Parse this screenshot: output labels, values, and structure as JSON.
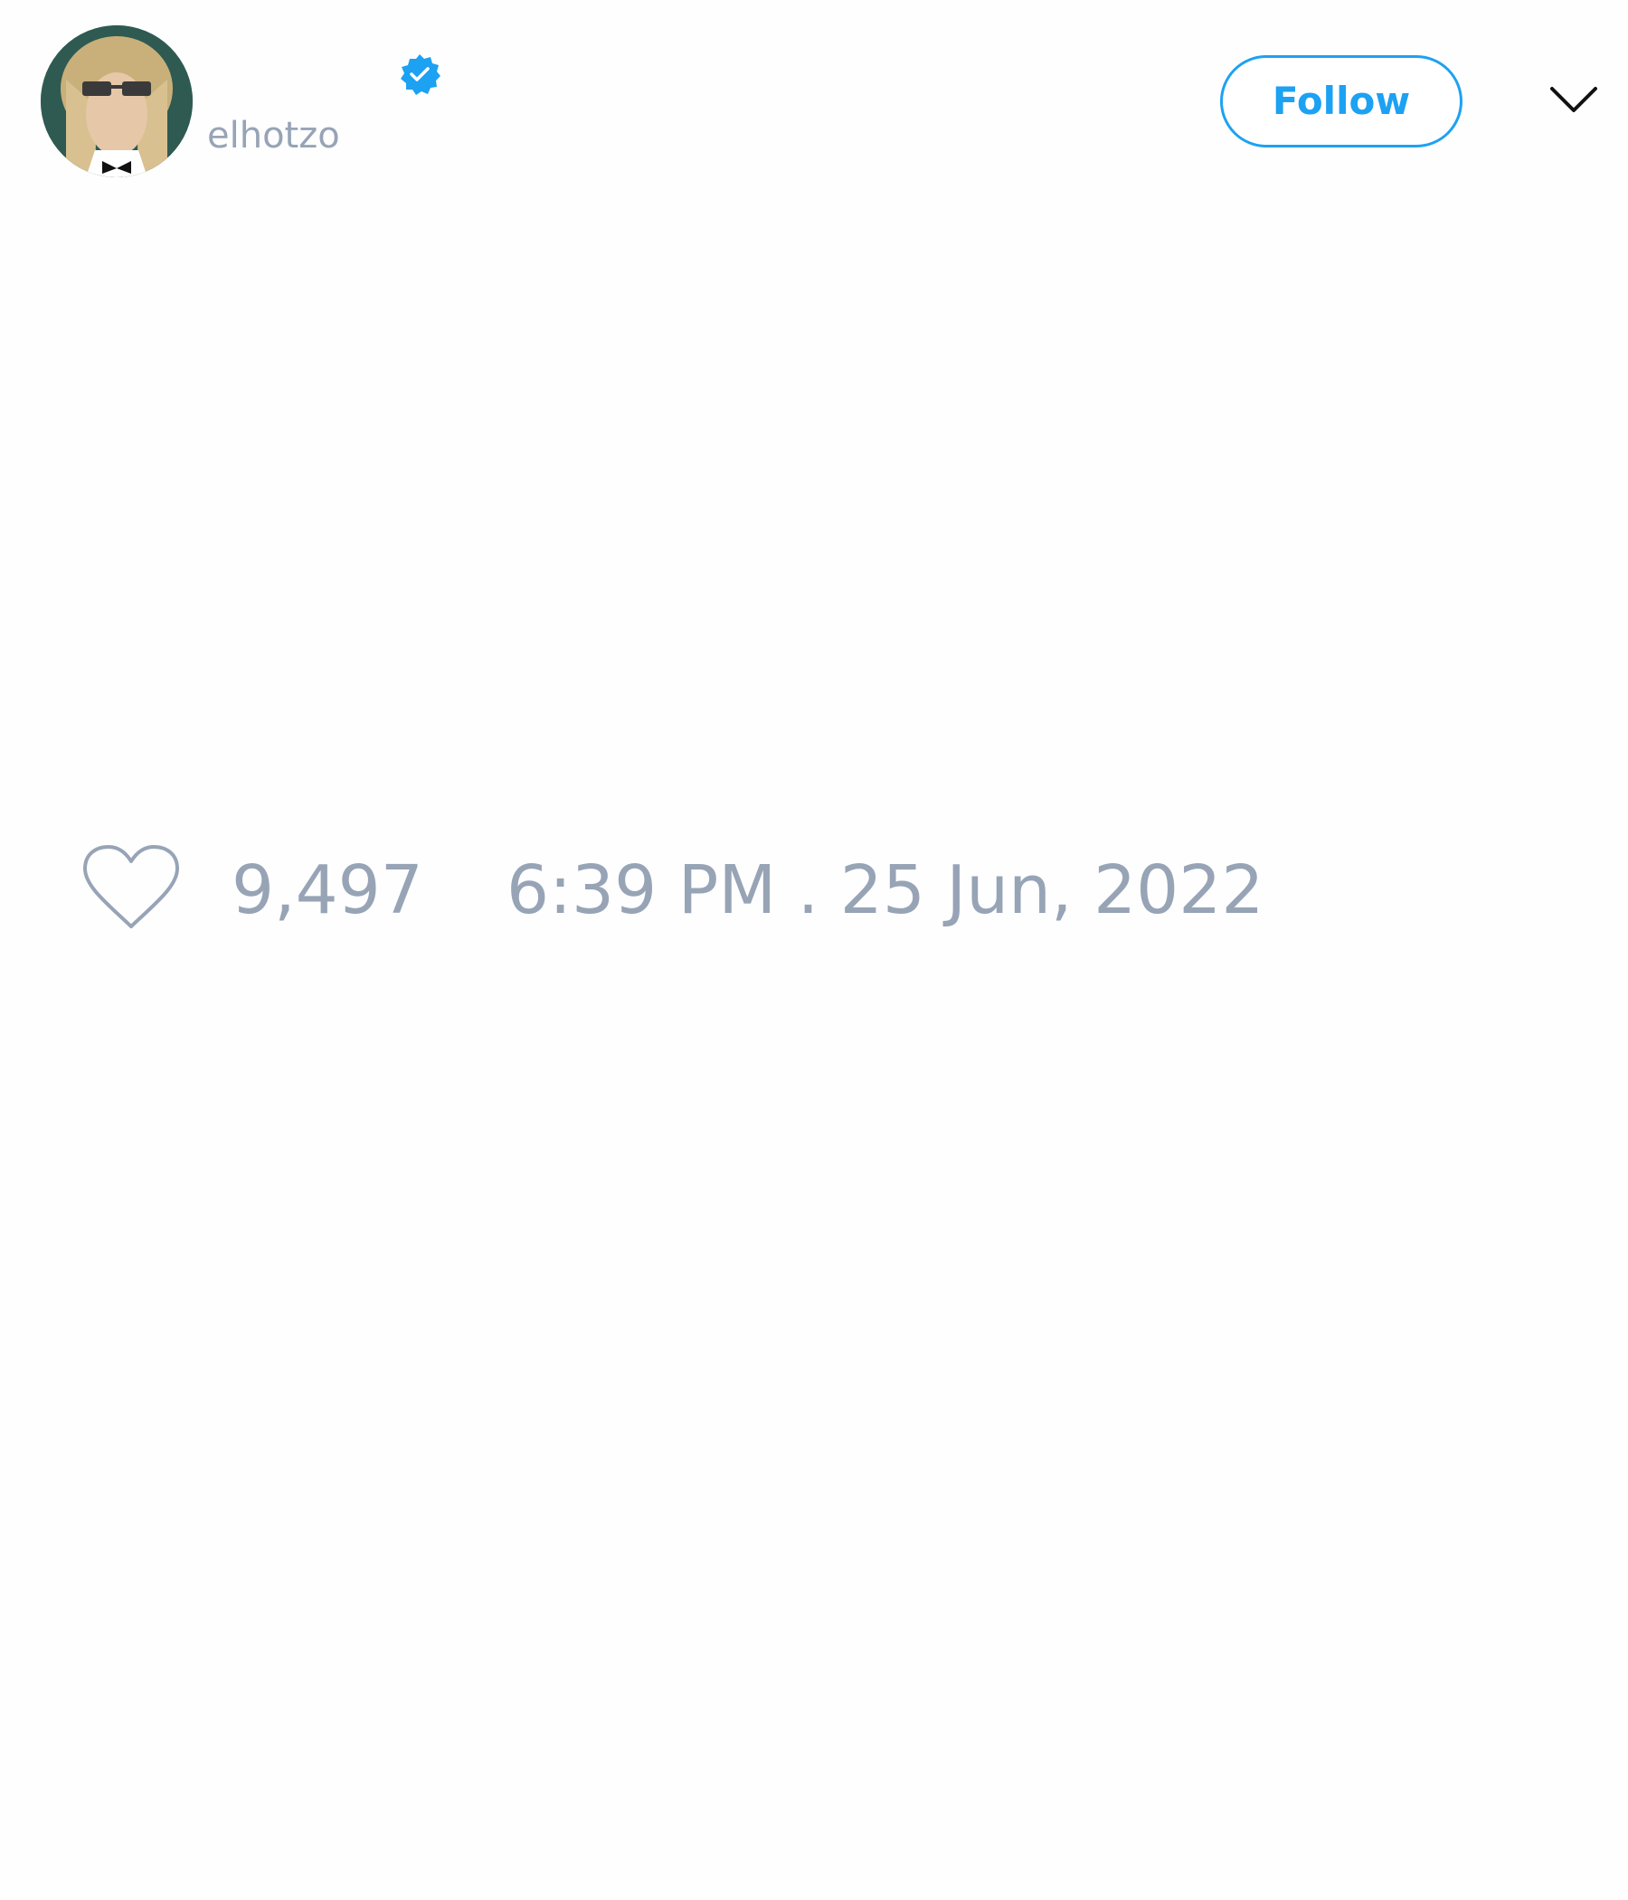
{
  "author": {
    "username": "elhotzo",
    "verified": true
  },
  "actions": {
    "follow_label": "Follow"
  },
  "icons": {
    "avatar": "profile-photo",
    "verified": "verified-badge-icon",
    "menu": "chevron-down-icon",
    "like": "heart-icon"
  },
  "stats": {
    "likes": "9,497",
    "timestamp": "6:39 PM . 25 Jun, 2022"
  },
  "colors": {
    "accent": "#1da1f2",
    "muted_text": "#97a4b6",
    "background": "#fefefe"
  }
}
